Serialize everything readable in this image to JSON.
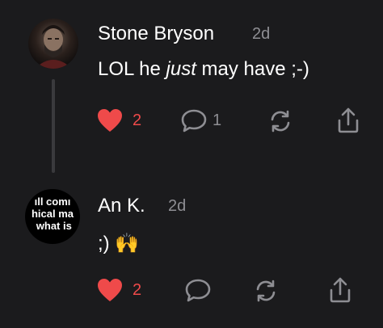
{
  "comments": [
    {
      "author": "Stone Bryson",
      "time": "2d",
      "text_before": "LOL he ",
      "text_italic": "just",
      "text_after": " may have ;-)",
      "likes": "2",
      "replies": "1"
    },
    {
      "author": "An K.",
      "time": "2d",
      "text": ";) 🙌",
      "avatar_text": "ıll comı\nhical ma\n what is",
      "likes": "2"
    }
  ],
  "icons": {
    "like": "heart-icon",
    "reply": "comment-bubble-icon",
    "repost": "repost-icon",
    "share": "share-icon"
  },
  "colors": {
    "background": "#1b1b1d",
    "like_active": "#ef4a4a",
    "muted": "#8e8e93"
  }
}
